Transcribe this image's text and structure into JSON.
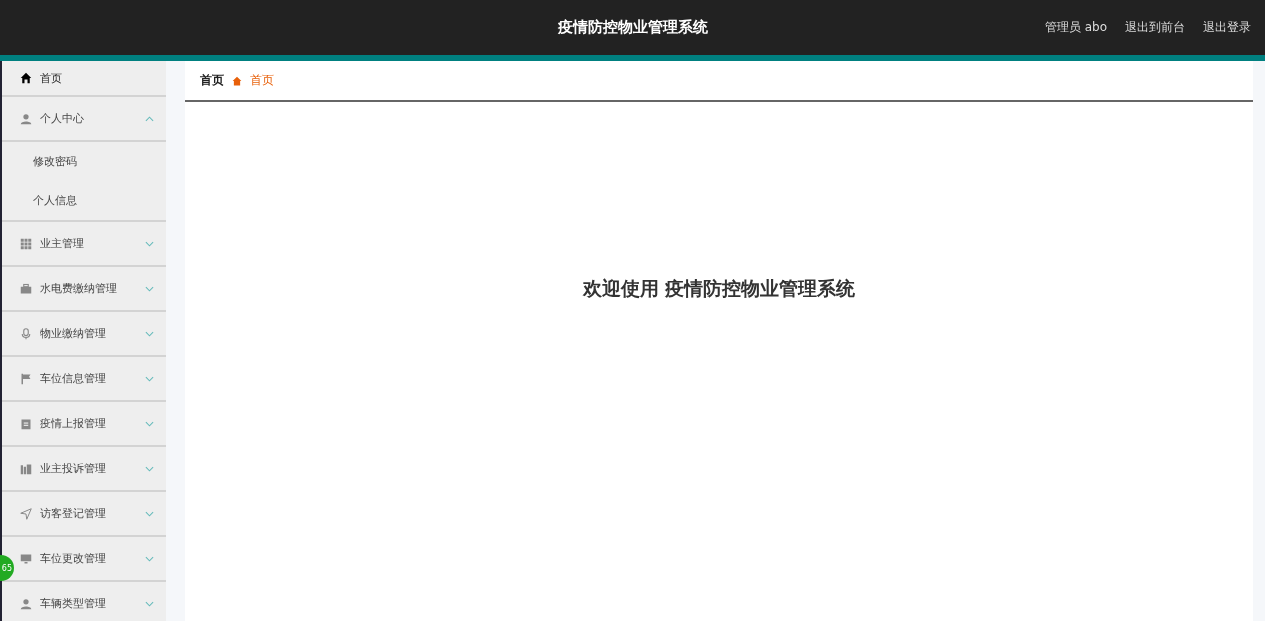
{
  "header": {
    "title": "疫情防控物业管理系统",
    "user": "管理员 abo",
    "links": [
      "退出到前台",
      "退出登录"
    ]
  },
  "sidebar": {
    "items": [
      {
        "kind": "link",
        "label": "首页"
      },
      {
        "kind": "group",
        "label": "个人中心",
        "expanded": true,
        "children": [
          {
            "label": "修改密码"
          },
          {
            "label": "个人信息"
          }
        ]
      },
      {
        "kind": "group",
        "label": "业主管理",
        "expanded": false
      },
      {
        "kind": "group",
        "label": "水电费缴纳管理",
        "expanded": false
      },
      {
        "kind": "group",
        "label": "物业缴纳管理",
        "expanded": false
      },
      {
        "kind": "group",
        "label": "车位信息管理",
        "expanded": false
      },
      {
        "kind": "group",
        "label": "疫情上报管理",
        "expanded": false
      },
      {
        "kind": "group",
        "label": "业主投诉管理",
        "expanded": false
      },
      {
        "kind": "group",
        "label": "访客登记管理",
        "expanded": false
      },
      {
        "kind": "group",
        "label": "车位更改管理",
        "expanded": false
      },
      {
        "kind": "group",
        "label": "车辆类型管理",
        "expanded": false
      }
    ]
  },
  "floating_badge": "65",
  "breadcrumb": [
    "首页",
    "首页"
  ],
  "welcome": "欢迎使用 疫情防控物业管理系统"
}
